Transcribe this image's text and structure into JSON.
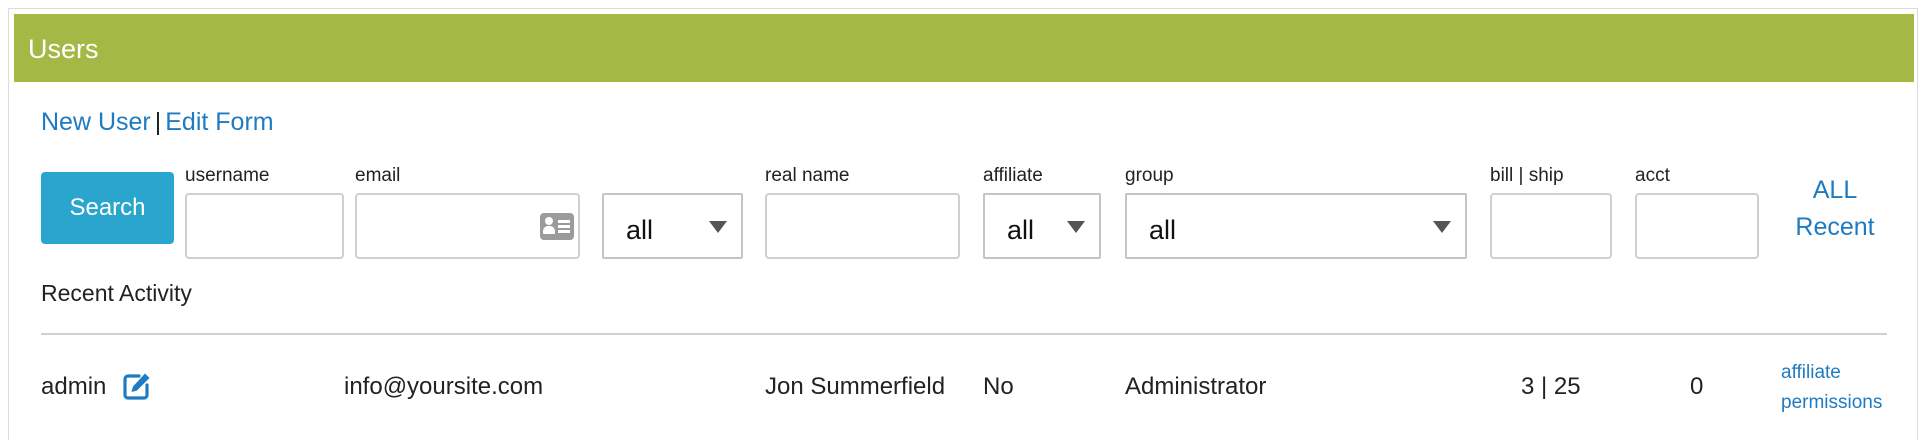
{
  "panel": {
    "title": "Users",
    "header_color": "#a4b845"
  },
  "top_links": {
    "new_user": "New User",
    "separator": "|",
    "edit_form": "Edit Form"
  },
  "search": {
    "button_label": "Search",
    "fields": {
      "username": {
        "label": "username",
        "value": ""
      },
      "email": {
        "label": "email",
        "value": ""
      },
      "email_scope": {
        "value": "all"
      },
      "real_name": {
        "label": "real name",
        "value": ""
      },
      "affiliate": {
        "label": "affiliate",
        "value": "all"
      },
      "group": {
        "label": "group",
        "value": "all"
      },
      "bill_ship": {
        "label": "bill | ship",
        "value": ""
      },
      "acct": {
        "label": "acct",
        "value": ""
      }
    },
    "right_links": {
      "all": "ALL",
      "recent": "Recent"
    }
  },
  "recent": {
    "title": "Recent Activity",
    "rows": [
      {
        "username": "admin",
        "email": "info@yoursite.com",
        "real_name": "Jon Summerfield",
        "affiliate": "No",
        "group": "Administrator",
        "bill_ship": "3 | 25",
        "acct": "0",
        "actions": [
          "affiliate",
          "permissions"
        ]
      }
    ]
  },
  "colors": {
    "link": "#1f7bc1",
    "button": "#2aa5cd"
  },
  "icons": {
    "email_field": "contact-card-icon",
    "edit": "edit-icon"
  }
}
